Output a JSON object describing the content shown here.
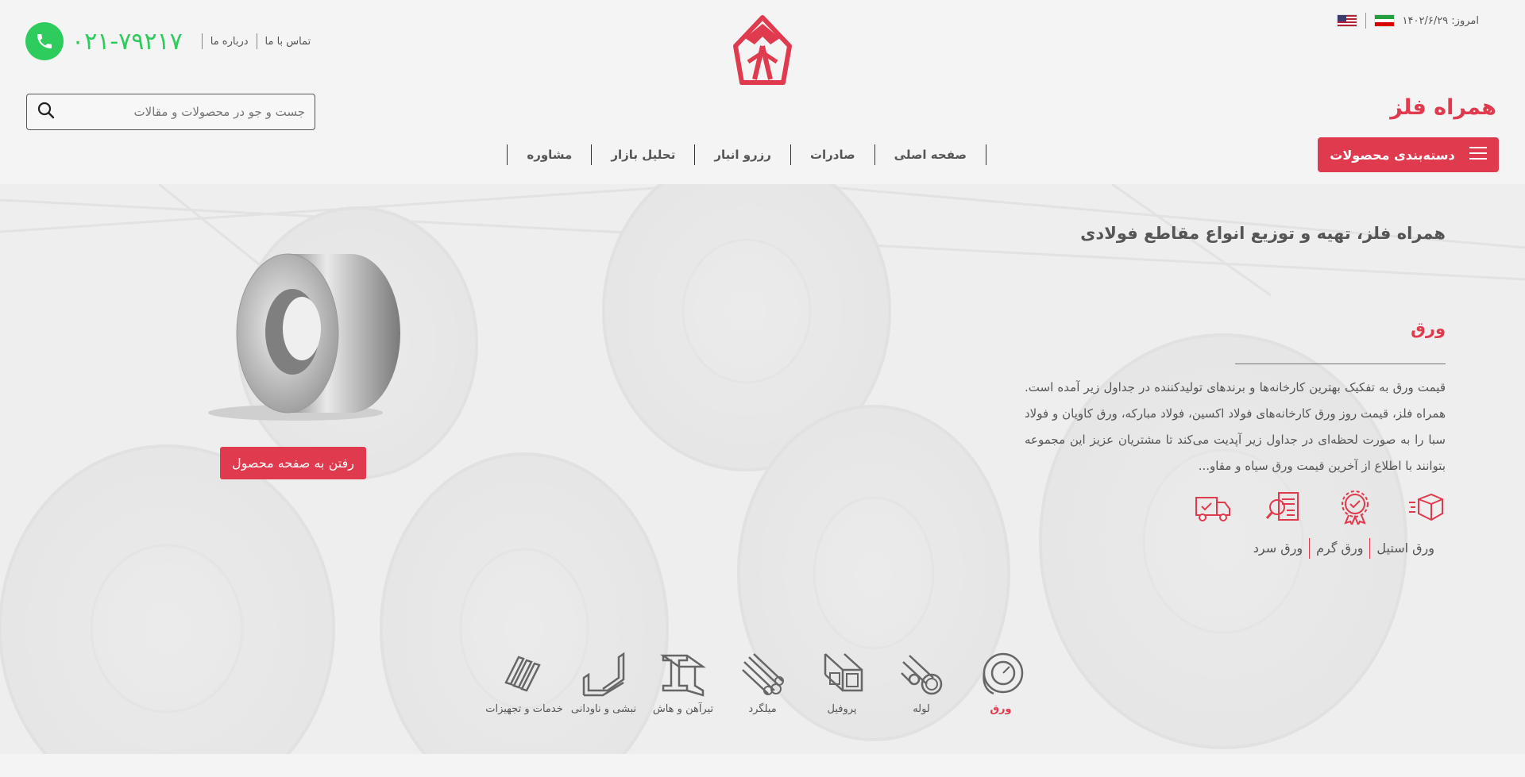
{
  "header": {
    "phone": "۰۲۱-۷۹۲۱۷",
    "links": [
      "درباره ما",
      "تماس با ما"
    ],
    "date_label": "امروز: ۱۴۰۲/۶/۲۹",
    "brand": "همراه فلز",
    "search_placeholder": "جست و جو در محصولات و مقالات",
    "categories_button": "دسته‌بندی محصولات",
    "nav": [
      "صفحه اصلی",
      "صادرات",
      "رزرو انبار",
      "تحلیل بازار",
      "مشاوره"
    ]
  },
  "hero": {
    "title": "همراه فلز، تهیه و توزیع انواع مقاطع فولادی",
    "section_title": "ورق",
    "description": "قیمت ورق به تفکیک بهترین کارخانه‌ها و برندهای تولیدکننده در جداول زیر آمده است. همراه فلز، قیمت روز ورق کارخانه‌های فولاد اکسین، فولاد مبارکه، ورق کاویان و فولاد سبا را به صورت لحظه‌ای در جداول زیر آپدیت می‌کند تا مشتریان عزیز این مجموعه بتوانند با اطلاع از آخرین قیمت ورق سیاه و مقاو...",
    "tags": [
      "ورق استیل",
      "ورق گرم",
      "ورق سرد"
    ],
    "product_button": "رفتن به صفحه محصول"
  },
  "categories": [
    {
      "label": "ورق",
      "icon": "coil-icon",
      "active": true
    },
    {
      "label": "لوله",
      "icon": "pipe-icon"
    },
    {
      "label": "پروفیل",
      "icon": "profile-icon"
    },
    {
      "label": "میلگرد",
      "icon": "rebar-icon"
    },
    {
      "label": "تیرآهن و هاش",
      "icon": "ibeam-icon"
    },
    {
      "label": "نبشی و ناودانی",
      "icon": "angle-icon"
    },
    {
      "label": "خدمات و تجهیزات",
      "icon": "services-icon"
    }
  ],
  "colors": {
    "accent": "#e03a4e",
    "phone": "#2ecc5c"
  }
}
